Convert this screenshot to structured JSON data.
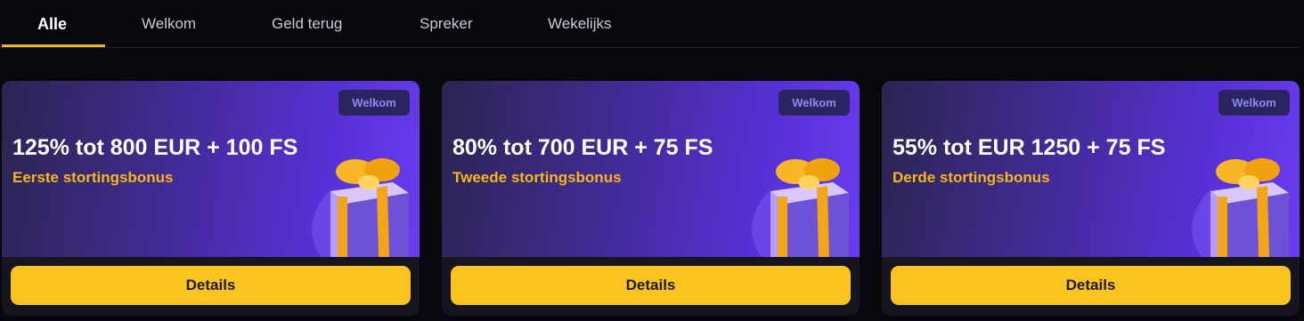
{
  "tabs": [
    {
      "label": "Alle"
    },
    {
      "label": "Welkom"
    },
    {
      "label": "Geld terug"
    },
    {
      "label": "Spreker"
    },
    {
      "label": "Wekelijks"
    }
  ],
  "active_tab": "Alle",
  "cards": [
    {
      "badge": "Welkom",
      "title": "125% tot 800 EUR + 100 FS",
      "subtitle": "Eerste stortingsbonus",
      "button": "Details",
      "icon": "gift-icon"
    },
    {
      "badge": "Welkom",
      "title": "80% tot 700 EUR + 75 FS",
      "subtitle": "Tweede stortingsbonus",
      "button": "Details",
      "icon": "gift-icon"
    },
    {
      "badge": "Welkom",
      "title": "55% tot EUR 1250 + 75 FS",
      "subtitle": "Derde stortingsbonus",
      "button": "Details",
      "icon": "gift-icon"
    }
  ],
  "colors": {
    "accent": "#fac31f",
    "subtitle": "#f5b61e",
    "banner": "#5630d4",
    "background": "#07070d"
  }
}
